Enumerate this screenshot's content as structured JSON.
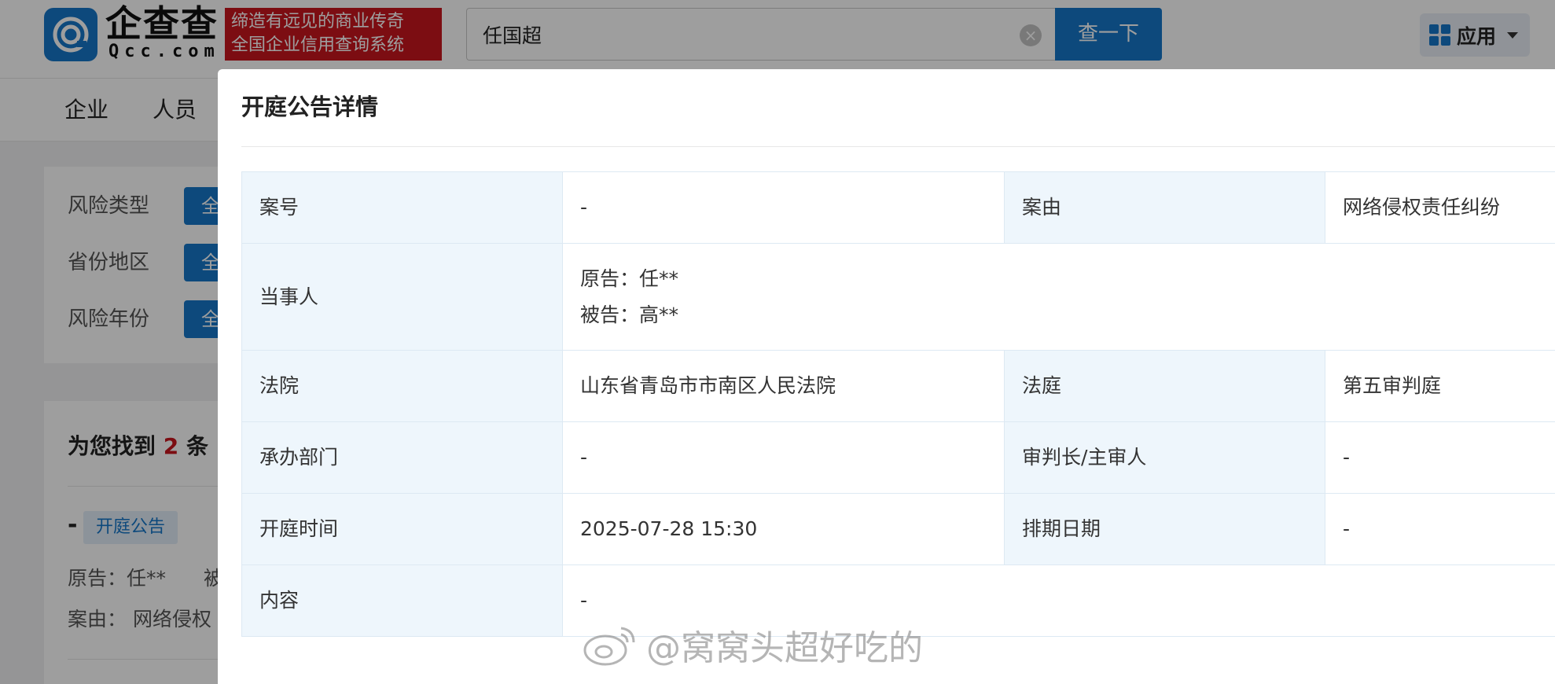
{
  "header": {
    "logo_text": "企查查",
    "logo_domain": "Qcc.com",
    "slogan_line1": "缔造有远见的商业传奇",
    "slogan_line2": "全国企业信用查询系统",
    "search_value": "任国超",
    "search_button": "查一下",
    "apps_label": "应用"
  },
  "nav": {
    "items": [
      "企业",
      "人员"
    ]
  },
  "filters": {
    "rows": [
      {
        "label": "风险类型",
        "chip": "全"
      },
      {
        "label": "省份地区",
        "chip": "全"
      },
      {
        "label": "风险年份",
        "chip": "全"
      }
    ]
  },
  "results": {
    "title_prefix": "为您找到",
    "count": "2",
    "title_suffix": "条",
    "item_dash": "-",
    "item_tag": "开庭公告",
    "item_plaintiff": "原告：任**",
    "item_plaintiff_more": "被",
    "item_cause": "案由：  网络侵权"
  },
  "modal": {
    "title": "开庭公告详情",
    "rows": {
      "case_no_label": "案号",
      "case_no_value": "-",
      "cause_label": "案由",
      "cause_value": "网络侵权责任纠纷",
      "party_label": "当事人",
      "plaintiff": "原告：任**",
      "defendant": "被告：高**",
      "court_label": "法院",
      "court_value": "山东省青岛市市南区人民法院",
      "courtroom_label": "法庭",
      "courtroom_value": "第五审判庭",
      "dept_label": "承办部门",
      "dept_value": "-",
      "judge_label": "审判长/主审人",
      "judge_value": "-",
      "time_label": "开庭时间",
      "time_value": "2025-07-28 15:30",
      "schedule_label": "排期日期",
      "schedule_value": "-",
      "content_label": "内容",
      "content_value": "-"
    }
  },
  "watermark": {
    "text": "@窝窝头超好吃的"
  }
}
